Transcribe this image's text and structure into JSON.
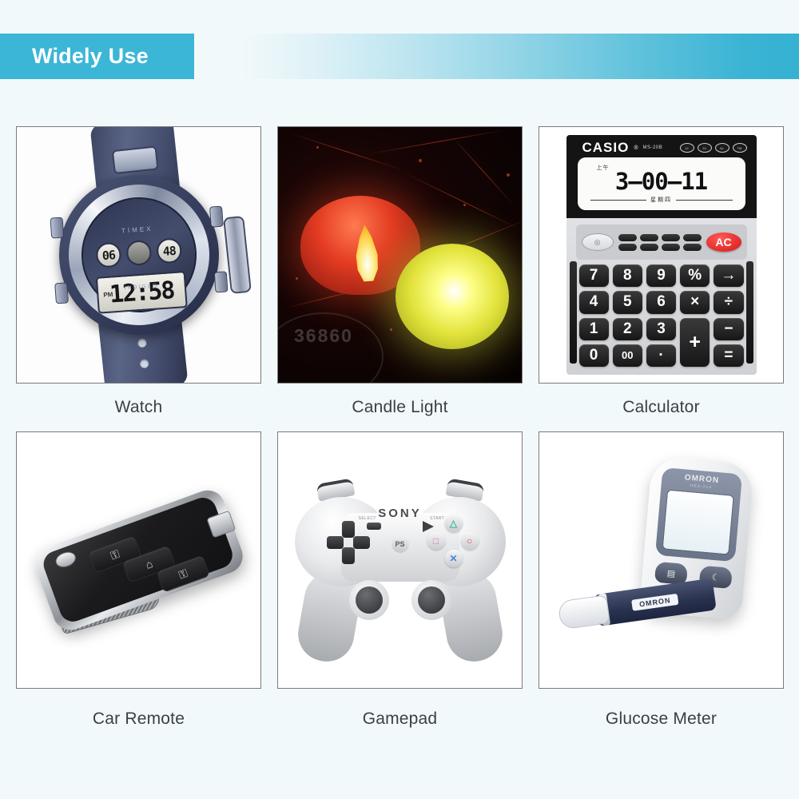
{
  "header": {
    "title": "Widely Use",
    "chip_color": "#3bb6d6",
    "band_color": "#35b1d2"
  },
  "page": {
    "background_color": "#f2f9fb",
    "card_border_color": "#7b7b7b",
    "caption_color": "#3a3f45"
  },
  "cards": [
    {
      "caption": "Watch",
      "icon": "digital-watch",
      "watch": {
        "main_time": "12:58",
        "subdial_left": "06",
        "subdial_right": "48",
        "subdial_mid": "",
        "side_label": "PM",
        "brand": "TIMEX",
        "sub_label": "INDIGLO",
        "strap_color": "#3d4663",
        "bezel_color": "#e9edf4"
      }
    },
    {
      "caption": "Candle Light",
      "icon": "led-tealight-candles",
      "candle": {
        "red_candle_color": "#e33b22",
        "yellow_candle_color": "#e2e33c",
        "flame_color": "#ffd24a",
        "background_color": "#140404",
        "emblem_text": "36860"
      }
    },
    {
      "caption": "Calculator",
      "icon": "casio-calculator",
      "calculator": {
        "brand": "CASIO",
        "registered_mark": "®",
        "model": "MS-20B",
        "display_small": "上午",
        "display_main": "3—00—11",
        "display_footer_cn": "星期四",
        "ac_label": "AC",
        "solar_label": "◎",
        "keys": [
          "7",
          "8",
          "9",
          "%",
          "→",
          "4",
          "5",
          "6",
          "×",
          "÷",
          "1",
          "2",
          "3",
          "+",
          "−",
          "0",
          "00",
          "·",
          "=",
          ""
        ],
        "top_icon_count": 4,
        "fn_key_count": 8,
        "ac_color": "#d8150f"
      }
    },
    {
      "caption": "Car Remote",
      "icon": "car-key-fob",
      "remote": {
        "button_lock": "⚿",
        "button_trunk": "⌂",
        "button_unlock": "⚿",
        "body_color": "#1b1b1d",
        "chrome_color": "#c3c6cb"
      }
    },
    {
      "caption": "Gamepad",
      "icon": "sony-dualshock-controller",
      "gamepad": {
        "brand": "SONY",
        "face_triangle": "△",
        "face_square": "□",
        "face_circle": "○",
        "face_cross": "✕",
        "label_select": "SELECT",
        "label_start": "START",
        "ps_label": "PS",
        "triangle_color": "#3fbf9a",
        "square_color": "#d76fae",
        "circle_color": "#e0494f",
        "cross_color": "#4a86d8",
        "body_color": "#e9eaec"
      }
    },
    {
      "caption": "Glucose Meter",
      "icon": "omron-glucose-meter",
      "glucose": {
        "brand": "OMRON",
        "model": "HEA-214",
        "lancet_brand": "OMRON",
        "button_left": "▤",
        "button_right": "☾",
        "body_color": "#f0f1f3",
        "faceplate_color": "#6a7488",
        "lancet_color": "#2b3450"
      }
    }
  ]
}
